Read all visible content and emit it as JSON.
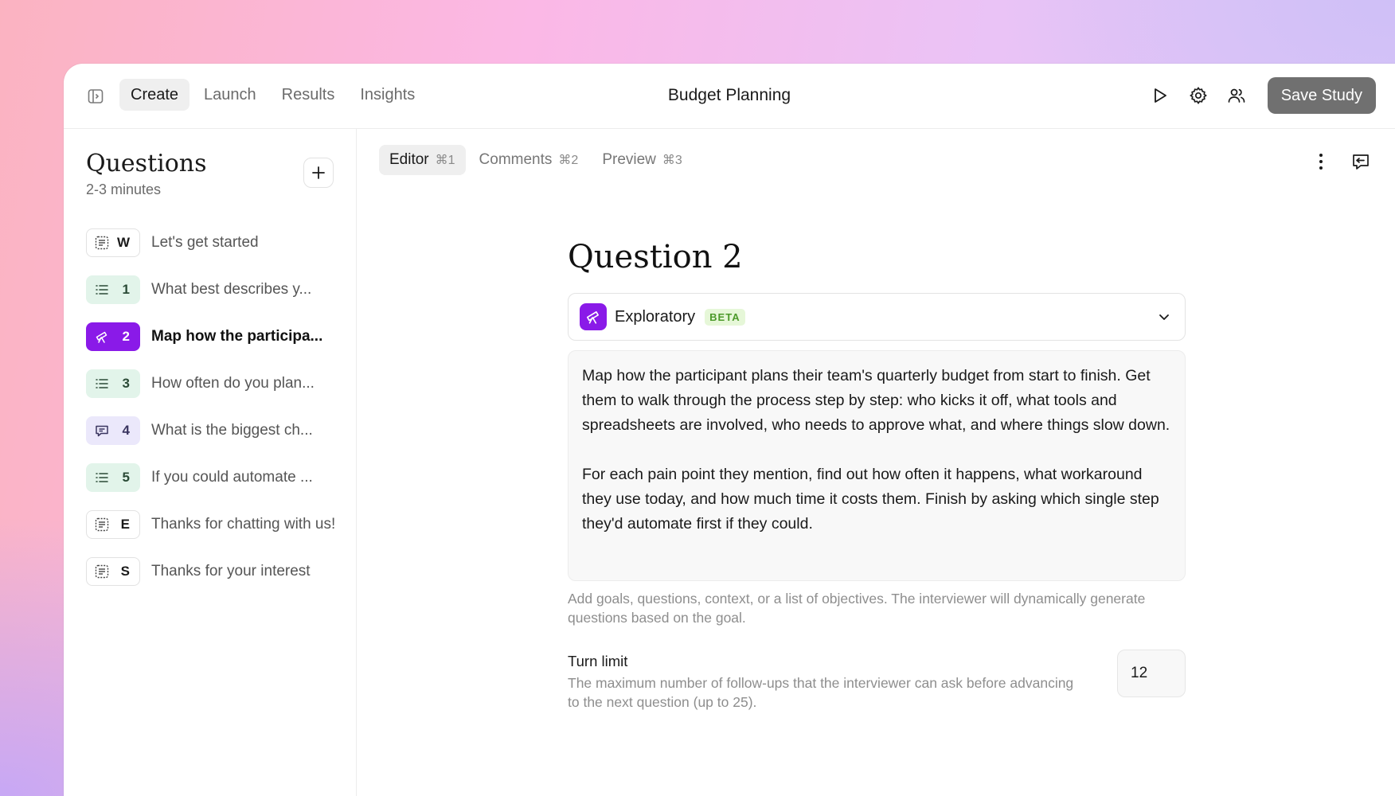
{
  "header": {
    "tabs": [
      {
        "label": "Create",
        "active": true
      },
      {
        "label": "Launch",
        "active": false
      },
      {
        "label": "Results",
        "active": false
      },
      {
        "label": "Insights",
        "active": false
      }
    ],
    "title": "Budget Planning",
    "save_label": "Save Study",
    "icons": [
      "sidebar-toggle-icon",
      "play-icon",
      "gear-icon",
      "users-icon"
    ]
  },
  "questions_panel": {
    "title": "Questions",
    "subtitle": "2-3 minutes",
    "items": [
      {
        "badge": "W",
        "text": "Let's get started",
        "icon": "doc-text-icon",
        "style": "outline"
      },
      {
        "badge": "1",
        "text": "What best describes y...",
        "icon": "list-icon",
        "style": "green"
      },
      {
        "badge": "2",
        "text": "Map how the participa...",
        "icon": "telescope-icon",
        "style": "purple",
        "active": true
      },
      {
        "badge": "3",
        "text": "How often do you plan...",
        "icon": "list-icon",
        "style": "green"
      },
      {
        "badge": "4",
        "text": "What is the biggest ch...",
        "icon": "chat-icon",
        "style": "lavender"
      },
      {
        "badge": "5",
        "text": "If you could automate ...",
        "icon": "list-icon",
        "style": "green"
      },
      {
        "badge": "E",
        "text": "Thanks for chatting with us!",
        "icon": "doc-text-icon",
        "style": "outline"
      },
      {
        "badge": "S",
        "text": "Thanks for your interest",
        "icon": "doc-text-icon",
        "style": "outline"
      }
    ]
  },
  "subtabs": [
    {
      "label": "Editor",
      "shortcut": "⌘1",
      "active": true
    },
    {
      "label": "Comments",
      "shortcut": "⌘2",
      "active": false
    },
    {
      "label": "Preview",
      "shortcut": "⌘3",
      "active": false
    }
  ],
  "editor": {
    "heading": "Question 2",
    "type_label": "Exploratory",
    "type_badge": "BETA",
    "prompt": "Map how the participant plans their team's quarterly budget from start to finish. Get them to walk through the process step by step: who kicks it off, what tools and spreadsheets are involved, who needs to approve what, and where things slow down.\n\nFor each pain point they mention, find out how often it happens, what workaround they use today, and how much time it costs them. Finish by asking which single step they'd automate first if they could.",
    "helper": "Add goals, questions, context, or a list of objectives. The interviewer will dynamically generate questions based on the goal.",
    "turn_limit_label": "Turn limit",
    "turn_limit_desc": "The maximum number of follow-ups that the interviewer can ask before advancing to the next question (up to 25).",
    "turn_limit_value": "12"
  },
  "colors": {
    "accent_purple": "#8a1ae8",
    "badge_green": "#e2f4ea",
    "badge_lavender": "#ebe8fb",
    "save_button": "#707070",
    "beta_bg": "#e6f7d8",
    "beta_text": "#4c9a2a"
  }
}
